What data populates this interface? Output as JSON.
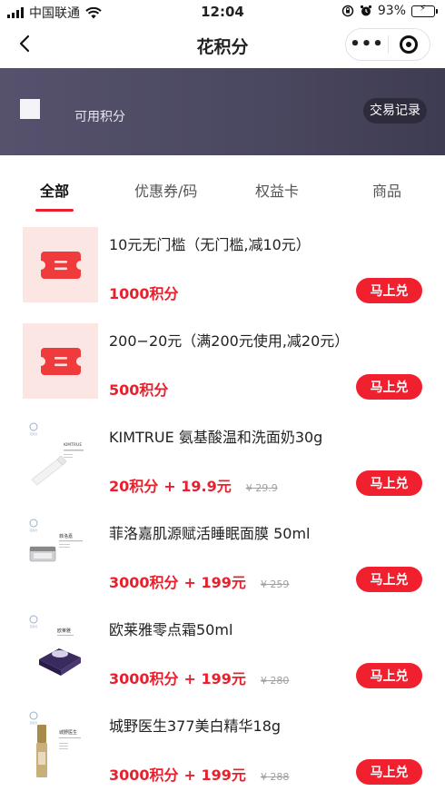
{
  "status_bar": {
    "carrier": "中国联通",
    "time": "12:04",
    "battery": "93%"
  },
  "nav": {
    "title": "花积分",
    "more_label": "•••"
  },
  "banner": {
    "label": "可用积分",
    "trade_record": "交易记录"
  },
  "tabs": [
    {
      "label": "全部",
      "active": true
    },
    {
      "label": "优惠券/码",
      "active": false
    },
    {
      "label": "权益卡",
      "active": false
    },
    {
      "label": "商品",
      "active": false
    }
  ],
  "items": [
    {
      "title": "10元无门槛（无门槛,减10元）",
      "points": "1000积分",
      "cash": "",
      "original": "",
      "button": "马上兑",
      "thumb": "coupon-ticket-icon"
    },
    {
      "title": "200−20元（满200元使用,减20元）",
      "points": "500积分",
      "cash": "",
      "original": "",
      "button": "马上兑",
      "thumb": "coupon-ticket-icon"
    },
    {
      "title": "KIMTRUE 氨基酸温和洗面奶30g",
      "points": "20积分",
      "cash": "+ 19.9元",
      "original": "¥ 29.9",
      "button": "马上兑",
      "thumb": "cleanser-tube-image"
    },
    {
      "title": "菲洛嘉肌源赋活睡眠面膜 50ml",
      "points": "3000积分",
      "cash": "+ 199元",
      "original": "¥ 259",
      "button": "马上兑",
      "thumb": "face-mask-jar-image"
    },
    {
      "title": "欧莱雅零点霜50ml",
      "points": "3000积分",
      "cash": "+ 199元",
      "original": "¥ 280",
      "button": "马上兑",
      "thumb": "night-cream-jar-image"
    },
    {
      "title": "城野医生377美白精华18g",
      "points": "3000积分",
      "cash": "+ 199元",
      "original": "¥ 288",
      "button": "马上兑",
      "thumb": "serum-bottle-image"
    }
  ],
  "thumb_text": {
    "kimtrue_brand": "KIMTRUE",
    "filorga_brand": "菲洛嘉",
    "loreal_brand": "欧莱雅",
    "drci_brand": "城野医生"
  },
  "colors": {
    "accent": "#e8202e",
    "banner": "#4a4760",
    "coupon_bg": "#fce6e4"
  }
}
